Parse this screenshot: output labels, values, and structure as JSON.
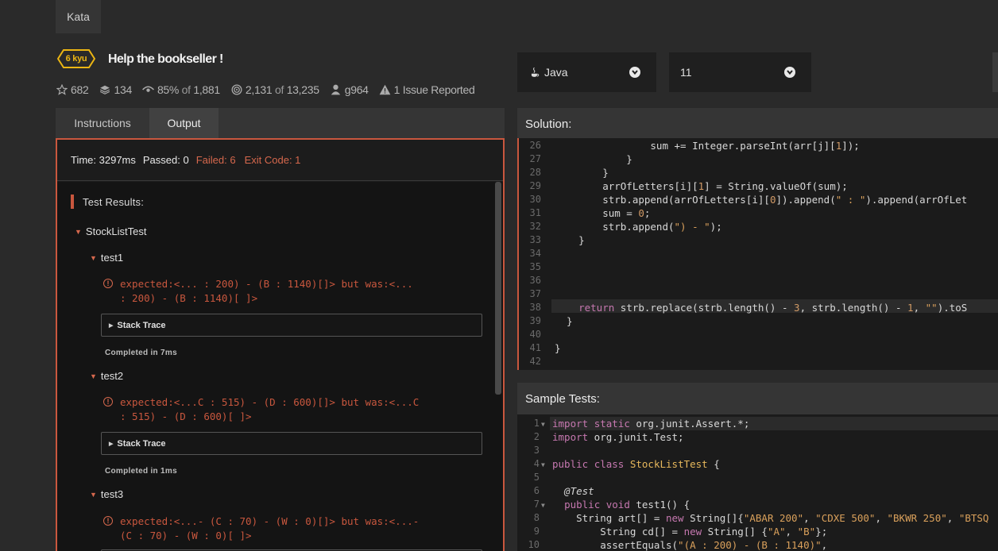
{
  "nav": {
    "kata_label": "Kata"
  },
  "kata": {
    "rank": "6 kyu",
    "title": "Help the bookseller !",
    "stats": {
      "stars": "682",
      "collections": "134",
      "satisfaction_pct": "85%",
      "satisfaction_of": "of",
      "satisfaction_total": "1,881",
      "completed": "2,131",
      "completed_of": "of",
      "completed_total": "13,235",
      "author": "g964",
      "issues": "1 Issue Reported"
    }
  },
  "language": {
    "selected": "Java",
    "version": "11"
  },
  "tabs": {
    "instructions": "Instructions",
    "output": "Output"
  },
  "output": {
    "time": "Time: 3297ms",
    "passed": "Passed: 0",
    "failed": "Failed: 6",
    "exit_code": "Exit Code: 1",
    "results_title": "Test Results:",
    "suite": "StockListTest",
    "stack_trace_label": "Stack Trace",
    "tests": [
      {
        "name": "test1",
        "error_line1": "expected:<... : 200) - (B : 1140)[]> but was:<...",
        "error_line2": ": 200) - (B : 1140)[ ]>",
        "completed": "Completed in 7ms"
      },
      {
        "name": "test2",
        "error_line1": "expected:<...C : 515) - (D : 600)[]> but was:<...C",
        "error_line2": ": 515) - (D : 600)[ ]>",
        "completed": "Completed in 1ms"
      },
      {
        "name": "test3",
        "error_line1": "expected:<...- (C : 70) - (W : 0)[]> but was:<...-",
        "error_line2": "(C : 70) - (W : 0)[ ]>"
      }
    ]
  },
  "solution": {
    "title": "Solution:",
    "line_numbers": [
      "26",
      "27",
      "28",
      "29",
      "30",
      "31",
      "32",
      "33",
      "34",
      "35",
      "36",
      "37",
      "38",
      "39",
      "40",
      "41",
      "42"
    ],
    "lines": [
      "                sum += Integer.parseInt(arr[j][1]);",
      "            }",
      "        }",
      "        arrOfLetters[i][1] = String.valueOf(sum);",
      "        strb.append(arrOfLetters[i][0]).append(\" : \").append(arrOfLet",
      "        sum = 0;",
      "        strb.append(\") - \");",
      "    }",
      "",
      "",
      "",
      "",
      "    return strb.replace(strb.length() - 3, strb.length() - 1, \"\").toS",
      "  }",
      "",
      "}",
      ""
    ]
  },
  "sample_tests": {
    "title": "Sample Tests:",
    "line_numbers": [
      "1",
      "2",
      "3",
      "4",
      "5",
      "6",
      "7",
      "8",
      "9",
      "10"
    ],
    "lines": [
      "import static org.junit.Assert.*;",
      "import org.junit.Test;",
      "",
      "public class StockListTest {",
      "",
      "  @Test",
      "  public void test1() {",
      "    String art[] = new String[]{\"ABAR 200\", \"CDXE 500\", \"BKWR 250\", \"BTSQ",
      "        String cd[] = new String[] {\"A\", \"B\"};",
      "        assertEquals(\"(A : 200) - (B : 1140)\","
    ]
  },
  "colors": {
    "accent": "#c9573e",
    "rank": "#ecb613",
    "background": "#2a2a2a"
  }
}
